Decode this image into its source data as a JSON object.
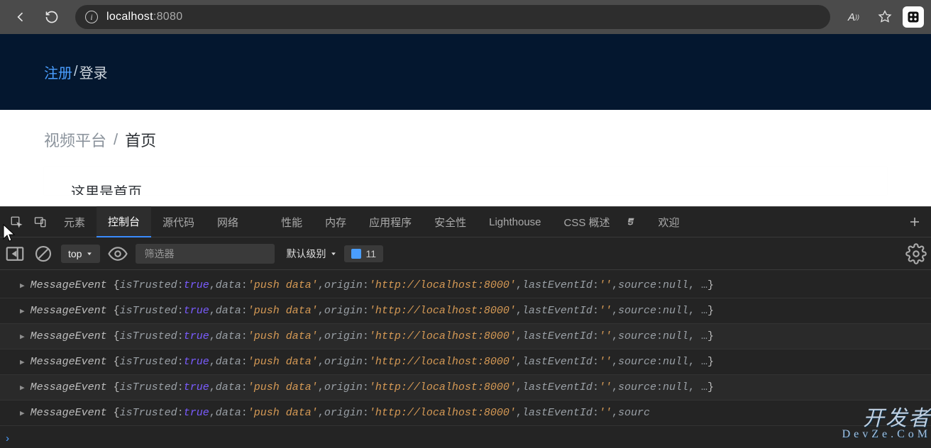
{
  "browser": {
    "url_host": "localhost",
    "url_port": ":8080"
  },
  "page": {
    "header_register": "注册",
    "header_sep": "/",
    "header_login": "登录",
    "breadcrumb_root": "视频平台",
    "breadcrumb_sep": "/",
    "breadcrumb_current": "首页",
    "card_text": "这里是首页"
  },
  "devtools": {
    "tabs": {
      "elements": "元素",
      "console": "控制台",
      "sources": "源代码",
      "network": "网络",
      "performance": "性能",
      "memory": "内存",
      "application": "应用程序",
      "security": "安全性",
      "lighthouse": "Lighthouse",
      "css_overview": "CSS 概述",
      "welcome": "欢迎"
    },
    "active_tab": "console",
    "context": "top",
    "filter_placeholder": "筛选器",
    "levels": "默认级别",
    "issues_count": "11"
  },
  "console_line": {
    "cls": "MessageEvent",
    "isTrusted": "true",
    "data": "'push data'",
    "origin": "'http://localhost:8000'",
    "lastEventId": "''",
    "source": "null"
  },
  "console_line_last": {
    "cls": "MessageEvent",
    "isTrusted": "true",
    "data": "'push data'",
    "origin": "'http://localhost:8000'",
    "lastEventId": "''",
    "source_key": "sourc"
  },
  "watermark": {
    "main": "开发者",
    "sub": "DevZe.CoM"
  }
}
